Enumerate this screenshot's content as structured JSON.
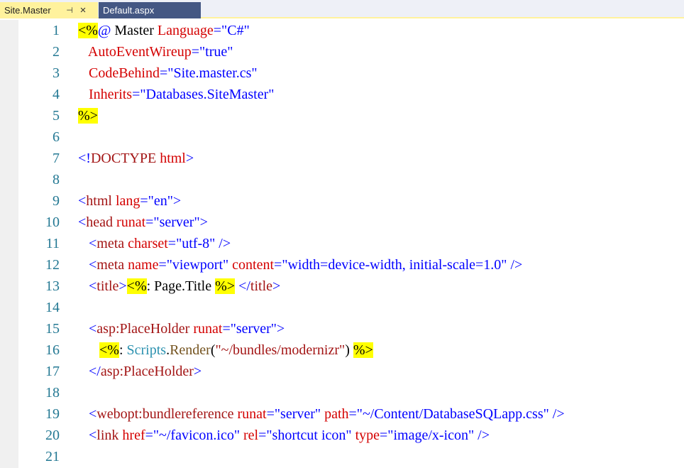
{
  "tabs": [
    {
      "label": "Site.Master",
      "active": true,
      "pin_glyph": "⊣",
      "close_glyph": "×"
    },
    {
      "label": "Default.aspx",
      "active": false
    }
  ],
  "colors": {
    "active_tab": "#fff29d",
    "inactive_tab": "#445783",
    "line_number": "#237893",
    "tag_blue": "#0000ff",
    "attribute_red": "#d40000",
    "element_maroon": "#a31515",
    "directive_highlight": "#ffff00",
    "class_teal": "#2b91af",
    "method_brown": "#74531f"
  },
  "editor": {
    "lines": [
      {
        "n": "1",
        "tokens": [
          [
            "hl",
            "<%"
          ],
          [
            "blue",
            "@"
          ],
          [
            "black",
            " Master "
          ],
          [
            "red",
            "Language"
          ],
          [
            "blue",
            "=\"C#\""
          ]
        ]
      },
      {
        "n": "2",
        "tokens": [
          [
            "red",
            "   AutoEventWireup"
          ],
          [
            "blue",
            "=\"true\""
          ]
        ]
      },
      {
        "n": "3",
        "tokens": [
          [
            "red",
            "   CodeBehind"
          ],
          [
            "blue",
            "=\"Site.master.cs\""
          ]
        ]
      },
      {
        "n": "4",
        "tokens": [
          [
            "red",
            "   Inherits"
          ],
          [
            "blue",
            "=\"Databases.SiteMaster\""
          ]
        ]
      },
      {
        "n": "5",
        "tokens": [
          [
            "hl",
            "%>"
          ]
        ]
      },
      {
        "n": "6",
        "tokens": []
      },
      {
        "n": "7",
        "tokens": [
          [
            "blue",
            "<!"
          ],
          [
            "maroon",
            "DOCTYPE"
          ],
          [
            "black",
            " "
          ],
          [
            "red",
            "html"
          ],
          [
            "blue",
            ">"
          ]
        ]
      },
      {
        "n": "8",
        "tokens": []
      },
      {
        "n": "9",
        "tokens": [
          [
            "blue",
            "<"
          ],
          [
            "maroon",
            "html"
          ],
          [
            "black",
            " "
          ],
          [
            "red",
            "lang"
          ],
          [
            "blue",
            "=\"en\">"
          ]
        ]
      },
      {
        "n": "10",
        "tokens": [
          [
            "blue",
            "<"
          ],
          [
            "maroon",
            "head"
          ],
          [
            "black",
            " "
          ],
          [
            "red",
            "runat"
          ],
          [
            "blue",
            "=\"server\">"
          ]
        ]
      },
      {
        "n": "11",
        "tokens": [
          [
            "blue",
            "   <"
          ],
          [
            "maroon",
            "meta"
          ],
          [
            "black",
            " "
          ],
          [
            "red",
            "charset"
          ],
          [
            "blue",
            "=\"utf-8\" />"
          ]
        ]
      },
      {
        "n": "12",
        "tokens": [
          [
            "blue",
            "   <"
          ],
          [
            "maroon",
            "meta"
          ],
          [
            "black",
            " "
          ],
          [
            "red",
            "name"
          ],
          [
            "blue",
            "=\"viewport\" "
          ],
          [
            "red",
            "content"
          ],
          [
            "blue",
            "=\"width=device-width, initial-scale=1.0\" />"
          ]
        ]
      },
      {
        "n": "13",
        "tokens": [
          [
            "blue",
            "   <"
          ],
          [
            "maroon",
            "title"
          ],
          [
            "blue",
            ">"
          ],
          [
            "hl",
            "<%"
          ],
          [
            "black",
            ": Page.Title "
          ],
          [
            "hl",
            "%>"
          ],
          [
            "black",
            " "
          ],
          [
            "blue",
            "</"
          ],
          [
            "maroon",
            "title"
          ],
          [
            "blue",
            ">"
          ]
        ]
      },
      {
        "n": "14",
        "tokens": []
      },
      {
        "n": "15",
        "tokens": [
          [
            "blue",
            "   <"
          ],
          [
            "maroon",
            "asp:PlaceHolder"
          ],
          [
            "black",
            " "
          ],
          [
            "red",
            "runat"
          ],
          [
            "blue",
            "=\"server\">"
          ]
        ]
      },
      {
        "n": "16",
        "tokens": [
          [
            "black",
            "      "
          ],
          [
            "hl",
            "<%"
          ],
          [
            "black",
            ": "
          ],
          [
            "teal",
            "Scripts"
          ],
          [
            "black",
            "."
          ],
          [
            "brown",
            "Render"
          ],
          [
            "black",
            "("
          ],
          [
            "maroon",
            "\"~/bundles/modernizr\""
          ],
          [
            "black",
            ") "
          ],
          [
            "hl",
            "%>"
          ]
        ]
      },
      {
        "n": "17",
        "tokens": [
          [
            "blue",
            "   </"
          ],
          [
            "maroon",
            "asp:PlaceHolder"
          ],
          [
            "blue",
            ">"
          ]
        ]
      },
      {
        "n": "18",
        "tokens": []
      },
      {
        "n": "19",
        "tokens": [
          [
            "blue",
            "   <"
          ],
          [
            "maroon",
            "webopt:bundlereference"
          ],
          [
            "black",
            " "
          ],
          [
            "red",
            "runat"
          ],
          [
            "blue",
            "=\"server\" "
          ],
          [
            "red",
            "path"
          ],
          [
            "blue",
            "=\"~/Content/DatabaseSQLapp.css\" />"
          ]
        ]
      },
      {
        "n": "20",
        "tokens": [
          [
            "blue",
            "   <"
          ],
          [
            "maroon",
            "link"
          ],
          [
            "black",
            " "
          ],
          [
            "red",
            "href"
          ],
          [
            "blue",
            "=\"~/favicon.ico\" "
          ],
          [
            "red",
            "rel"
          ],
          [
            "blue",
            "=\"shortcut icon\" "
          ],
          [
            "red",
            "type"
          ],
          [
            "blue",
            "=\"image/x-icon\" />"
          ]
        ]
      },
      {
        "n": "21",
        "tokens": []
      }
    ]
  }
}
